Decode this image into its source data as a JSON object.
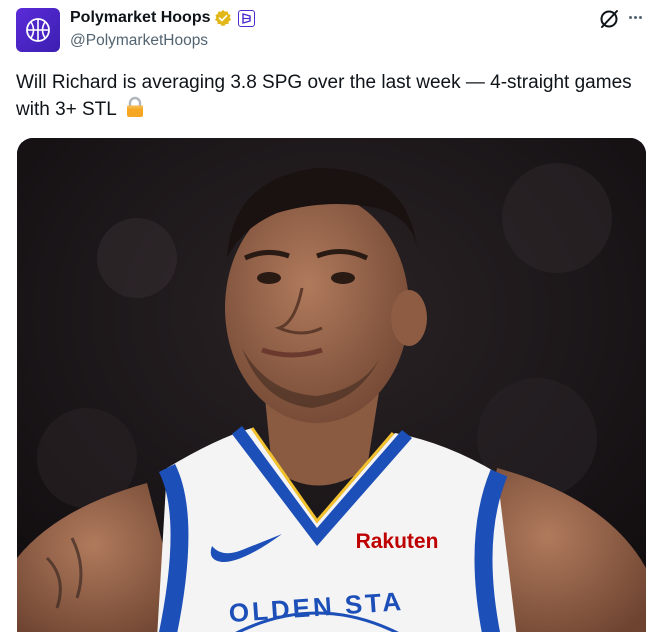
{
  "author": {
    "display_name": "Polymarket Hoops",
    "handle": "@PolymarketHoops",
    "avatar_icon": "basketball-logo-icon",
    "verified_icon": "verified-badge-icon",
    "affiliate_icon": "polymarket-affiliate-icon"
  },
  "actions": {
    "grok_icon": "grok-icon",
    "more_icon": "more-icon"
  },
  "tweet": {
    "text": "Will Richard is averaging 3.8 SPG over the last week — 4-straight games with 3+ STL",
    "emoji_icon": "lock-icon"
  },
  "media": {
    "jersey_sponsor": "Rakuten",
    "jersey_lettering": "OLDEN STA",
    "colors": {
      "jersey_blue": "#1d4fb8",
      "jersey_yellow": "#f2c12e",
      "rakuten_red": "#bf0000",
      "accent_purple": "#4b2bd0"
    }
  }
}
